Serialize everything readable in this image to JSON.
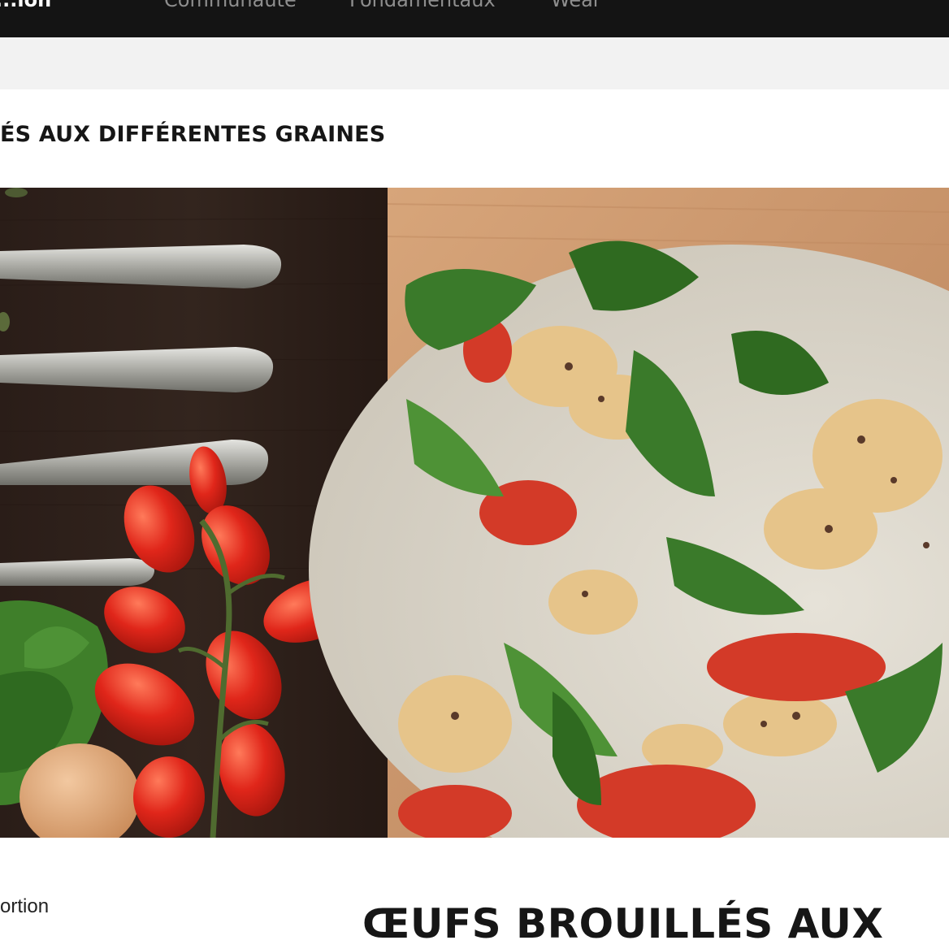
{
  "nav": {
    "brand": "...ion",
    "items": [
      "Communauté",
      "Fondamentaux",
      "Wear"
    ]
  },
  "page": {
    "heading": "ÉS AUX DIFFÉRENTES GRAINES"
  },
  "images": [
    {
      "name": "ingredients-photo"
    },
    {
      "name": "dish-photo"
    }
  ],
  "recipe": {
    "portion_label": "ortion",
    "title": "ŒUFS BROUILLÉS AUX"
  },
  "colors": {
    "nav_bg": "#141414",
    "subbar_bg": "#f2f2f2",
    "text": "#161616"
  }
}
